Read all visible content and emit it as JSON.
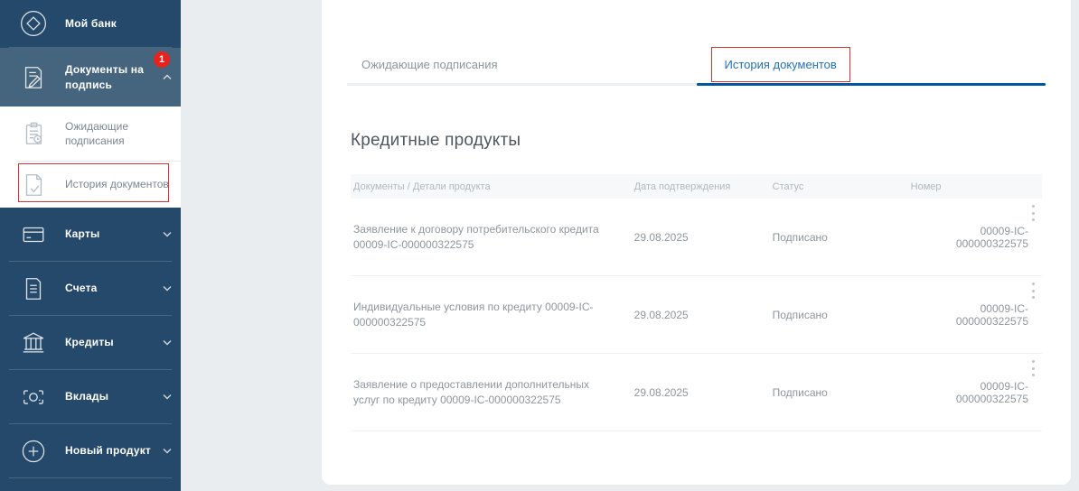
{
  "colors": {
    "sidebar_bg": "#25496a",
    "sidebar_active_bg": "#45647e",
    "badge_red": "#e8231d",
    "annotation_red": "#d0342c",
    "tab_active_blue": "#2471b8",
    "tab_underline_blue": "#0257a5",
    "page_bg": "#e9edf0"
  },
  "sidebar": {
    "brand": {
      "label": "Мой банк",
      "icon": "bank-logo-icon"
    },
    "documents_item": {
      "label": "Документы на подпись",
      "icon": "document-sign-icon",
      "badge": "1",
      "expanded": true
    },
    "submenu": {
      "pending": {
        "label": "Ожидающие подписания",
        "icon": "clipboard-clock-icon"
      },
      "history": {
        "label": "История документов",
        "icon": "document-check-icon",
        "annotated": true
      }
    },
    "items": [
      {
        "label": "Карты",
        "icon": "cards-icon"
      },
      {
        "label": "Счета",
        "icon": "accounts-icon"
      },
      {
        "label": "Кредиты",
        "icon": "credits-icon"
      },
      {
        "label": "Вклады",
        "icon": "deposits-icon"
      },
      {
        "label": "Новый продукт",
        "icon": "new-product-icon"
      }
    ]
  },
  "main": {
    "tabs": {
      "pending": {
        "label": "Ожидающие подписания",
        "active": false
      },
      "history": {
        "label": "История документов",
        "active": true,
        "annotated": true
      }
    },
    "section_title": "Кредитные продукты",
    "table": {
      "columns": [
        "Документы / Детали продукта",
        "Дата подтверждения",
        "Статус",
        "Номер"
      ],
      "rows": [
        {
          "document": "Заявление к договору потребительского кредита 00009-IC-000000322575",
          "date": "29.08.2025",
          "status": "Подписано",
          "number": "00009-IC-000000322575"
        },
        {
          "document": "Индивидуальные условия по кредиту 00009-IC-000000322575",
          "date": "29.08.2025",
          "status": "Подписано",
          "number": "00009-IC-000000322575"
        },
        {
          "document": "Заявление о предоставлении дополнительных услуг по кредиту 00009-IC-000000322575",
          "date": "29.08.2025",
          "status": "Подписано",
          "number": "00009-IC-000000322575"
        }
      ]
    }
  }
}
